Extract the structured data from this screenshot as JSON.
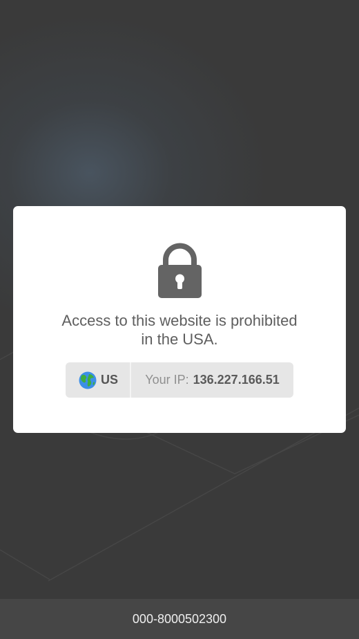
{
  "message": {
    "line1": "Access to this website is prohibited",
    "line2": "in the USA."
  },
  "info": {
    "country_icon": "globe-icon",
    "country_code": "US",
    "ip_label": "Your IP:",
    "ip_value": "136.227.166.51"
  },
  "footer": {
    "text": "000-8000502300"
  },
  "icons": {
    "lock": "lock-icon"
  },
  "colors": {
    "background": "#3a3a3a",
    "card": "#ffffff",
    "lock": "#646464",
    "text": "#5e5e5e",
    "info_box": "#e6e6e6",
    "footer": "#464646"
  }
}
